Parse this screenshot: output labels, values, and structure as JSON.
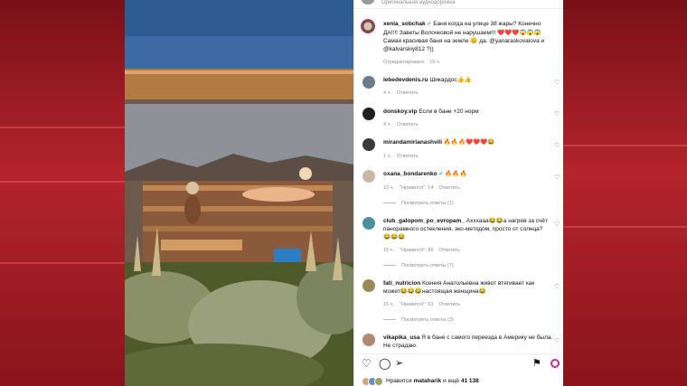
{
  "post": {
    "audio": "Оригинальная аудиодорожка",
    "author": "xenia_sobchak",
    "caption_line1": "Баня когда на улице 38 жары? Конечно",
    "caption_line2": "ДА!!!! Заветы Волочковой не нарушаем!!! ❤️❤️❤️😱😱😱",
    "caption_line3": "Самая красивая баня на земле 😊 да. @yanaraskovalova и",
    "caption_line4": "@kalvarskiy812 ?))",
    "edited": "Отредактировано",
    "time": "15 ч."
  },
  "comments": [
    {
      "user": "lebedevdenis.ru",
      "text": "Шикардос👍👍",
      "time": "4 ч.",
      "reply": "Ответить",
      "avatar_color": "#6b7c8d"
    },
    {
      "user": "donskoy.vip",
      "text": "Если в бане +20 норм",
      "time": "4 ч.",
      "reply": "Ответить",
      "avatar_color": "#1f1f1f"
    },
    {
      "user": "mirandamirianashvili",
      "text": "🔥🔥🔥❤️❤️❤️😂",
      "time": "1 ч.",
      "reply": "Ответить",
      "avatar_color": "#3a3a3a"
    },
    {
      "user": "oxana_bondarenko",
      "text": "🔥🔥🔥",
      "time": "13 ч.",
      "likes": "\"Нравится\": 14",
      "reply": "Ответить",
      "see_replies": "Посмотреть ответы (1)",
      "avatar_color": "#c9b8a8"
    },
    {
      "user": "club_galopom_po_evropam_",
      "text_line1": "Ахххааа😂😂а нагрев за счёт",
      "text_line2": "панорамного остекления, эко-методом, просто от солнца?",
      "text_line3": "😂😂😂",
      "time": "15 ч.",
      "likes": "\"Нравится\": 86",
      "reply": "Ответить",
      "see_replies": "Посмотреть ответы (7)",
      "avatar_color": "#4a90a0"
    },
    {
      "user": "fati_nutricion",
      "text_line1": "Ксения Анатольевна живот втягивает как",
      "text_line2": "может😂😂😂настоящая женщина😂",
      "time": "15 ч.",
      "likes": "\"Нравится\": 63",
      "reply": "Ответить",
      "see_replies": "Посмотреть ответы (3)",
      "avatar_color": "#9a8a5a"
    },
    {
      "user": "vikapika_usa",
      "text_line1": "Я в бане с самого переезда в Америку не была.",
      "text_line2": "Не страдаю.",
      "avatar_color": "#b08a70"
    }
  ],
  "footer": {
    "likes_text": "Нравится",
    "liked_by": "mataharik",
    "and_more": "и ещё",
    "count": "41 138"
  }
}
